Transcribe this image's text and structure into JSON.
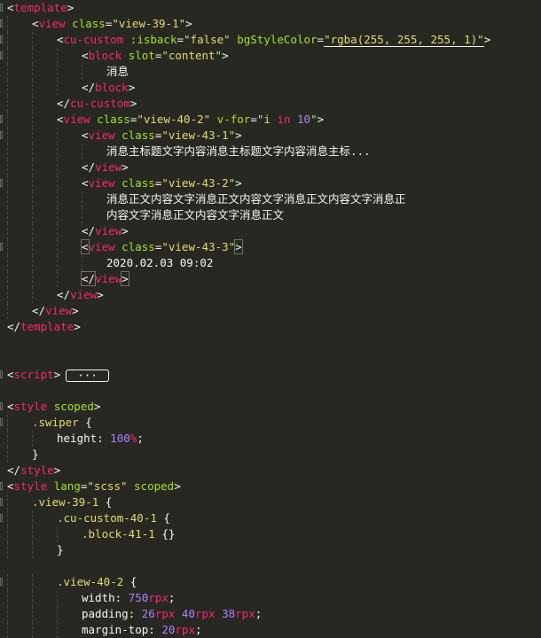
{
  "editor": {
    "theme": "monokai",
    "colors": {
      "background": "#272822",
      "tag": "#f92672",
      "attribute": "#a6e22e",
      "string": "#e6db74",
      "text": "#f8f8f2",
      "number": "#ae81ff"
    },
    "lines": [
      {
        "indent": 0,
        "fold": true,
        "tokens": [
          [
            "punc",
            "<"
          ],
          [
            "tag",
            "template"
          ],
          [
            "punc",
            ">"
          ]
        ]
      },
      {
        "indent": 1,
        "fold": true,
        "tokens": [
          [
            "punc",
            "<"
          ],
          [
            "tag",
            "view"
          ],
          [
            "punc",
            " "
          ],
          [
            "attr",
            "class"
          ],
          [
            "punc",
            "="
          ],
          [
            "str",
            "\"view-39-1\""
          ],
          [
            "punc",
            ">"
          ]
        ]
      },
      {
        "indent": 2,
        "fold": true,
        "tokens": [
          [
            "punc",
            "<"
          ],
          [
            "tag",
            "cu-custom"
          ],
          [
            "punc",
            " "
          ],
          [
            "attr",
            ":isback"
          ],
          [
            "punc",
            "="
          ],
          [
            "str",
            "\"false\""
          ],
          [
            "punc",
            " "
          ],
          [
            "attr",
            "bgStyleColor"
          ],
          [
            "punc",
            "="
          ],
          [
            "strhl",
            "\"rgba(255, 255, 255, 1)\""
          ],
          [
            "punc",
            ">"
          ]
        ]
      },
      {
        "indent": 3,
        "fold": true,
        "tokens": [
          [
            "punc",
            "<"
          ],
          [
            "tag",
            "block"
          ],
          [
            "punc",
            " "
          ],
          [
            "attr",
            "slot"
          ],
          [
            "punc",
            "="
          ],
          [
            "str",
            "\"content\""
          ],
          [
            "punc",
            ">"
          ]
        ]
      },
      {
        "indent": 4,
        "fold": false,
        "tokens": [
          [
            "text",
            "消息"
          ]
        ]
      },
      {
        "indent": 3,
        "fold": false,
        "tokens": [
          [
            "punc",
            "</"
          ],
          [
            "tag",
            "block"
          ],
          [
            "punc",
            ">"
          ]
        ]
      },
      {
        "indent": 2,
        "fold": false,
        "tokens": [
          [
            "punc",
            "</"
          ],
          [
            "tag",
            "cu-custom"
          ],
          [
            "punc",
            ">"
          ]
        ]
      },
      {
        "indent": 2,
        "fold": true,
        "tokens": [
          [
            "punc",
            "<"
          ],
          [
            "tag",
            "view"
          ],
          [
            "punc",
            " "
          ],
          [
            "attr",
            "class"
          ],
          [
            "punc",
            "="
          ],
          [
            "str",
            "\"view-40-2\""
          ],
          [
            "punc",
            " "
          ],
          [
            "attr",
            "v-for"
          ],
          [
            "punc",
            "="
          ],
          [
            "str",
            "\"i "
          ],
          [
            "kw",
            "in"
          ],
          [
            "str",
            " "
          ],
          [
            "num",
            "10"
          ],
          [
            "str",
            "\""
          ],
          [
            "punc",
            ">"
          ]
        ]
      },
      {
        "indent": 3,
        "fold": true,
        "tokens": [
          [
            "punc",
            "<"
          ],
          [
            "tag",
            "view"
          ],
          [
            "punc",
            " "
          ],
          [
            "attr",
            "class"
          ],
          [
            "punc",
            "="
          ],
          [
            "str",
            "\"view-43-1\""
          ],
          [
            "punc",
            ">"
          ]
        ]
      },
      {
        "indent": 4,
        "fold": false,
        "tokens": [
          [
            "text",
            "消息主标题文字内容消息主标题文字内容消息主标..."
          ]
        ]
      },
      {
        "indent": 3,
        "fold": false,
        "tokens": [
          [
            "punc",
            "</"
          ],
          [
            "tag",
            "view"
          ],
          [
            "punc",
            ">"
          ]
        ]
      },
      {
        "indent": 3,
        "fold": true,
        "tokens": [
          [
            "punc",
            "<"
          ],
          [
            "tag",
            "view"
          ],
          [
            "punc",
            " "
          ],
          [
            "attr",
            "class"
          ],
          [
            "punc",
            "="
          ],
          [
            "str",
            "\"view-43-2\""
          ],
          [
            "punc",
            ">"
          ]
        ]
      },
      {
        "indent": 4,
        "fold": false,
        "tokens": [
          [
            "text",
            "消息正文内容文字消息正文内容文字消息正文内容文字消息正"
          ]
        ]
      },
      {
        "indent": 4,
        "fold": false,
        "tokens": [
          [
            "text",
            "内容文字消息正文内容文字消息正文"
          ]
        ]
      },
      {
        "indent": 3,
        "fold": false,
        "tokens": [
          [
            "punc",
            "</"
          ],
          [
            "tag",
            "view"
          ],
          [
            "punc",
            ">"
          ]
        ]
      },
      {
        "indent": 3,
        "fold": true,
        "tokens": [
          [
            "boxpunc",
            "<"
          ],
          [
            "tag",
            "view"
          ],
          [
            "punc",
            " "
          ],
          [
            "attr",
            "class"
          ],
          [
            "punc",
            "="
          ],
          [
            "str",
            "\"view-43-3\""
          ],
          [
            "boxpunc",
            ">"
          ]
        ]
      },
      {
        "indent": 4,
        "fold": false,
        "tokens": [
          [
            "text",
            "2020.02.03 09:02"
          ]
        ]
      },
      {
        "indent": 3,
        "fold": false,
        "tokens": [
          [
            "boxpunc",
            "</"
          ],
          [
            "tag",
            "view"
          ],
          [
            "boxpunc",
            ">"
          ]
        ]
      },
      {
        "indent": 2,
        "fold": false,
        "tokens": [
          [
            "punc",
            "</"
          ],
          [
            "tag",
            "view"
          ],
          [
            "punc",
            ">"
          ]
        ]
      },
      {
        "indent": 1,
        "fold": false,
        "tokens": [
          [
            "punc",
            "</"
          ],
          [
            "tag",
            "view"
          ],
          [
            "punc",
            ">"
          ]
        ]
      },
      {
        "indent": 0,
        "fold": false,
        "tokens": [
          [
            "punc",
            "</"
          ],
          [
            "tag",
            "template"
          ],
          [
            "punc",
            ">"
          ]
        ]
      },
      {
        "indent": 0,
        "fold": false,
        "tokens": []
      },
      {
        "indent": 0,
        "fold": false,
        "tokens": []
      },
      {
        "indent": 0,
        "fold": true,
        "tokens": [
          [
            "punc",
            "<"
          ],
          [
            "tag",
            "script"
          ],
          [
            "punc",
            ">"
          ],
          [
            "ellipsis",
            "···"
          ]
        ]
      },
      {
        "indent": 0,
        "fold": false,
        "tokens": []
      },
      {
        "indent": 0,
        "fold": true,
        "tokens": [
          [
            "punc",
            "<"
          ],
          [
            "tag",
            "style"
          ],
          [
            "punc",
            " "
          ],
          [
            "attr",
            "scoped"
          ],
          [
            "punc",
            ">"
          ]
        ]
      },
      {
        "indent": 1,
        "fold": true,
        "tokens": [
          [
            "sel",
            ".swiper"
          ],
          [
            "punc",
            " {"
          ]
        ]
      },
      {
        "indent": 2,
        "fold": false,
        "tokens": [
          [
            "prop",
            "height"
          ],
          [
            "punc",
            ": "
          ],
          [
            "num",
            "100"
          ],
          [
            "unit",
            "%"
          ],
          [
            "punc",
            ";"
          ]
        ]
      },
      {
        "indent": 1,
        "fold": false,
        "tokens": [
          [
            "punc",
            "}"
          ]
        ]
      },
      {
        "indent": 0,
        "fold": false,
        "tokens": [
          [
            "punc",
            "</"
          ],
          [
            "tag",
            "style"
          ],
          [
            "punc",
            ">"
          ]
        ]
      },
      {
        "indent": 0,
        "fold": true,
        "tokens": [
          [
            "punc",
            "<"
          ],
          [
            "tag",
            "style"
          ],
          [
            "punc",
            " "
          ],
          [
            "attr",
            "lang"
          ],
          [
            "punc",
            "="
          ],
          [
            "str",
            "\"scss\""
          ],
          [
            "punc",
            " "
          ],
          [
            "attr",
            "scoped"
          ],
          [
            "punc",
            ">"
          ]
        ]
      },
      {
        "indent": 1,
        "fold": true,
        "tokens": [
          [
            "sel",
            ".view-39-1"
          ],
          [
            "punc",
            " {"
          ]
        ]
      },
      {
        "indent": 2,
        "fold": true,
        "tokens": [
          [
            "sel",
            ".cu-custom-40-1"
          ],
          [
            "punc",
            " {"
          ]
        ]
      },
      {
        "indent": 3,
        "fold": false,
        "tokens": [
          [
            "sel",
            ".block-41-1"
          ],
          [
            "punc",
            " {}"
          ]
        ]
      },
      {
        "indent": 2,
        "fold": false,
        "tokens": [
          [
            "punc",
            "}"
          ]
        ]
      },
      {
        "indent": 0,
        "fold": false,
        "tokens": []
      },
      {
        "indent": 2,
        "fold": true,
        "tokens": [
          [
            "sel",
            ".view-40-2"
          ],
          [
            "punc",
            " {"
          ]
        ]
      },
      {
        "indent": 3,
        "fold": false,
        "tokens": [
          [
            "prop",
            "width"
          ],
          [
            "punc",
            ": "
          ],
          [
            "num",
            "750"
          ],
          [
            "unit",
            "rpx"
          ],
          [
            "punc",
            ";"
          ]
        ]
      },
      {
        "indent": 3,
        "fold": false,
        "tokens": [
          [
            "prop",
            "padding"
          ],
          [
            "punc",
            ": "
          ],
          [
            "num",
            "26"
          ],
          [
            "unit",
            "rpx"
          ],
          [
            "punc",
            " "
          ],
          [
            "num",
            "40"
          ],
          [
            "unit",
            "rpx"
          ],
          [
            "punc",
            " "
          ],
          [
            "num",
            "38"
          ],
          [
            "unit",
            "rpx"
          ],
          [
            "punc",
            ";"
          ]
        ]
      },
      {
        "indent": 3,
        "fold": false,
        "tokens": [
          [
            "prop",
            "margin-top"
          ],
          [
            "punc",
            ": "
          ],
          [
            "num",
            "20"
          ],
          [
            "unit",
            "rpx"
          ],
          [
            "punc",
            ";"
          ]
        ]
      }
    ]
  }
}
